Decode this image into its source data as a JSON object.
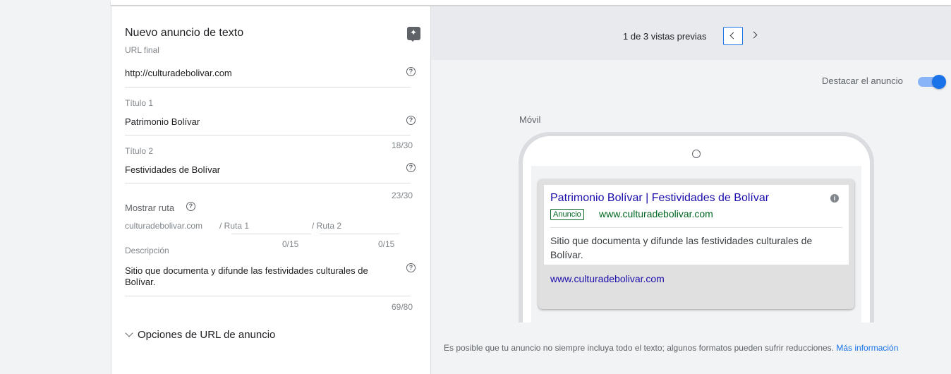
{
  "form": {
    "title": "Nuevo anuncio de texto",
    "final_url": {
      "label": "URL final",
      "value": "http://culturadebolivar.com"
    },
    "title1": {
      "label": "Título 1",
      "value": "Patrimonio Bolívar",
      "counter": "18/30"
    },
    "title2": {
      "label": "Título 2",
      "value": "Festividades de Bolívar",
      "counter": "23/30"
    },
    "path": {
      "label": "Mostrar ruta",
      "domain": "culturadebolivar.com",
      "path1_placeholder": "/ Ruta 1",
      "path2_placeholder": "/ Ruta 2",
      "path1_counter": "0/15",
      "path2_counter": "0/15"
    },
    "description": {
      "label": "Descripción",
      "value": "Sitio que documenta y difunde las festividades culturales de Bolívar.",
      "counter": "69/80"
    },
    "url_options_label": "Opciones de URL de anuncio"
  },
  "preview": {
    "count_text": "1 de 3 vistas previas",
    "highlight_label": "Destacar el anuncio",
    "highlight_on": true,
    "device_label": "Móvil",
    "ad": {
      "headline": "Patrimonio Bolívar | Festividades de Bolívar",
      "badge": "Anuncio",
      "display_url": "www.culturadebolivar.com",
      "description": "Sitio que documenta y difunde las festividades culturales de Bolívar.",
      "link": "www.culturadebolivar.com"
    },
    "disclaimer": "Es posible que tu anuncio no siempre incluya todo el texto; algunos formatos pueden sufrir reducciones.",
    "more_info": "Más información"
  },
  "icons": {
    "help": "?",
    "info": "i"
  },
  "colors": {
    "accent": "#1a73e8",
    "ad_headline": "#1a0dab",
    "ad_url": "#006621"
  }
}
